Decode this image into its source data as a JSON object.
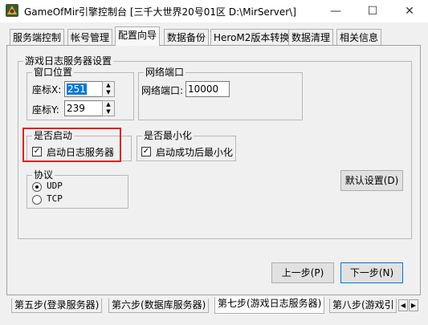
{
  "window": {
    "title": "GameOfMir引擎控制台 [三千大世界20号01区 D:\\MirServer\\]",
    "minimize_glyph": "—",
    "maximize_glyph": "☐",
    "close_glyph": "✕"
  },
  "top_tabs": [
    {
      "label": "服务端控制"
    },
    {
      "label": "帐号管理"
    },
    {
      "label": "配置向导"
    },
    {
      "label": "数据备份"
    },
    {
      "label": "HeroM2版本转换"
    },
    {
      "label": "数据清理"
    },
    {
      "label": "相关信息"
    }
  ],
  "outer_group": {
    "title": "游戏日志服务器设置"
  },
  "window_pos": {
    "title": "窗口位置",
    "x_label": "座标X:",
    "x_value": "251",
    "y_label": "座标Y:",
    "y_value": "239"
  },
  "net_port": {
    "title": "网络端口",
    "label": "网络端口:",
    "value": "10000"
  },
  "enable_group": {
    "title": "是否启动",
    "checkbox_label": "启动日志服务器",
    "checked": true
  },
  "minimize_group": {
    "title": "是否最小化",
    "checkbox_label": "启动成功后最小化",
    "checked": true
  },
  "protocol": {
    "title": "协议",
    "options": [
      {
        "label": "UDP",
        "selected": true
      },
      {
        "label": "TCP",
        "selected": false
      }
    ]
  },
  "buttons": {
    "default_settings": "默认设置(D)",
    "prev_step": "上一步(P)",
    "next_step": "下一步(N)"
  },
  "bottom_tabs": [
    {
      "label": "第五步(登录服务器)"
    },
    {
      "label": "第六步(数据库服务器)"
    },
    {
      "label": "第七步(游戏日志服务器)"
    },
    {
      "label": "第八步(游戏引"
    }
  ],
  "icons": {
    "tab_left": "◀",
    "tab_right": "▶",
    "spin_up": "▲",
    "spin_down": "▼",
    "check": "✓"
  },
  "colors": {
    "highlight_box": "#e02020",
    "selection": "#0078d7"
  }
}
